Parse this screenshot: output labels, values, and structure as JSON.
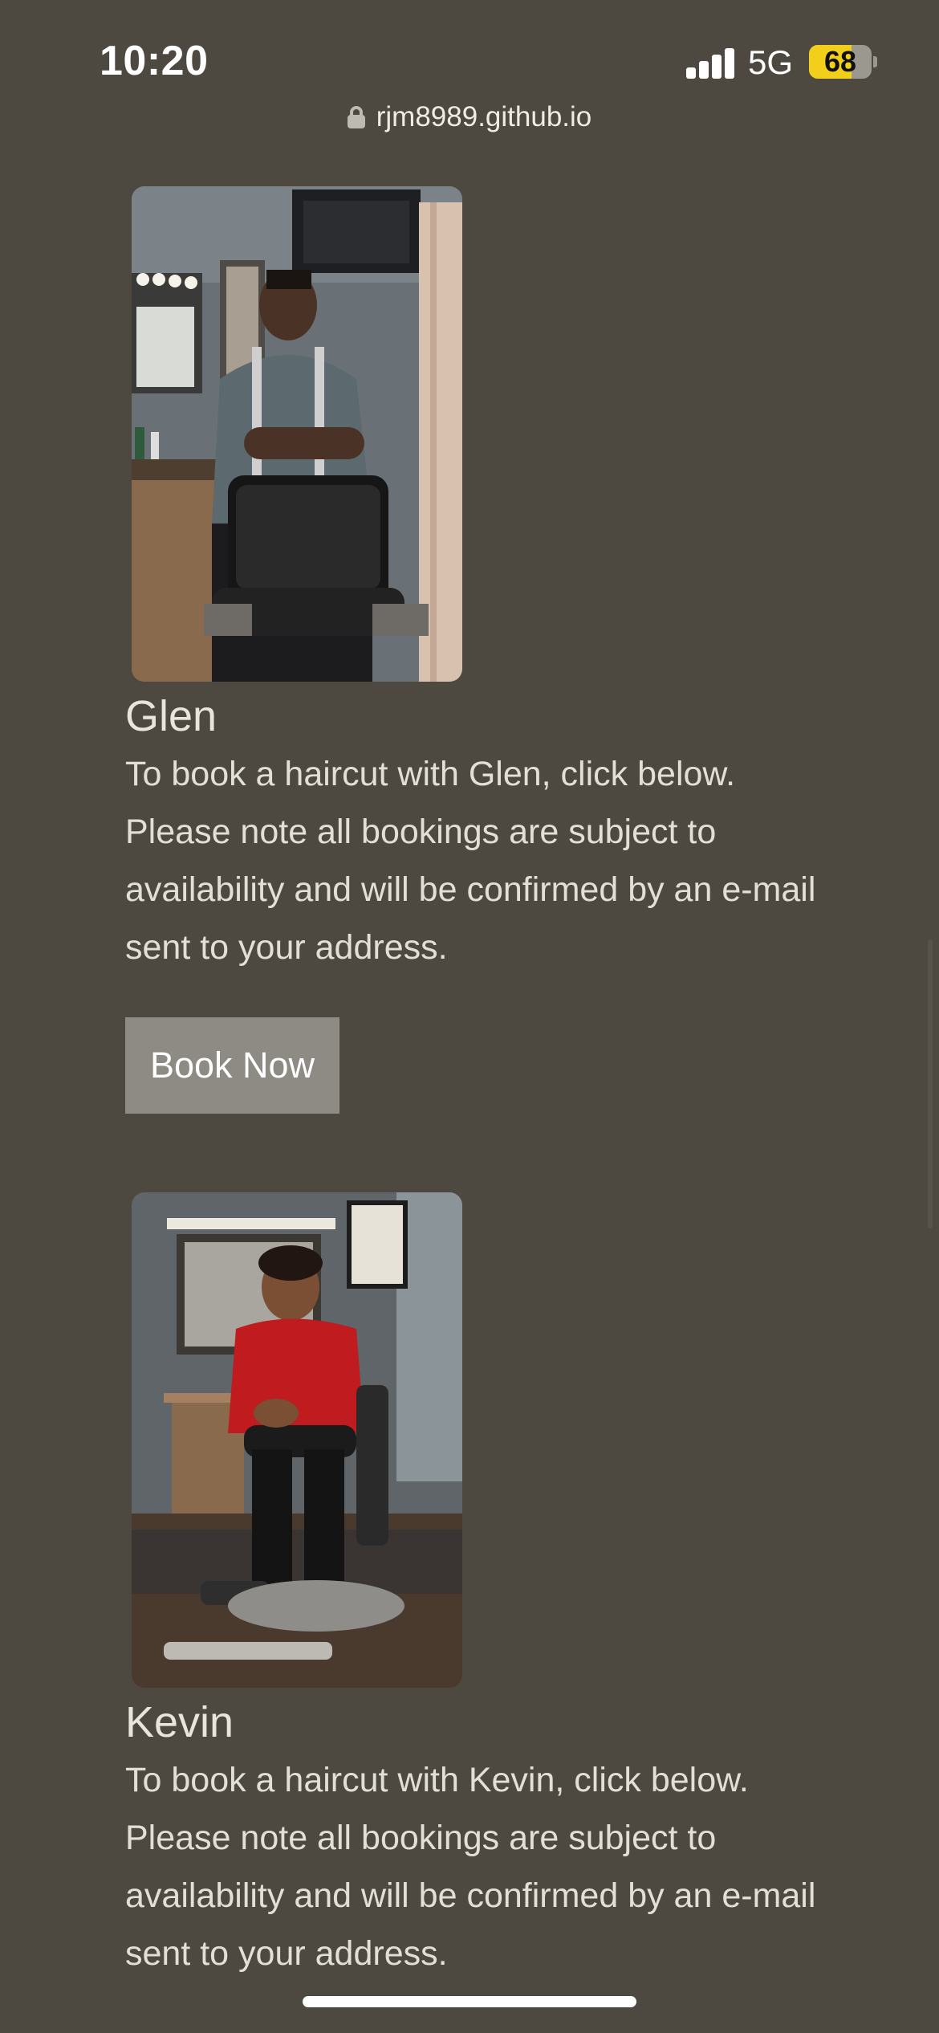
{
  "status_bar": {
    "time": "10:20",
    "network": "5G",
    "battery": "68",
    "battery_level": 0.68,
    "signal_icon": "signal-bars-icon",
    "battery_color": "#f2cf1b"
  },
  "browser": {
    "url": "rjm8989.github.io",
    "lock_icon": "lock-icon"
  },
  "barbers": [
    {
      "name": "Glen",
      "description": "To book a haircut with Glen, click below. Please note all bookings are subject to availability and will be confirmed by an e-mail sent to your address.",
      "button_label": "Book Now"
    },
    {
      "name": "Kevin",
      "description": "To book a haircut with Kevin, click below. Please note all bookings are subject to availability and will be confirmed by an e-mail sent to your address."
    }
  ],
  "colors": {
    "background": "#4d4940",
    "button": "#8e8b85",
    "text": "#e6e3dc"
  }
}
